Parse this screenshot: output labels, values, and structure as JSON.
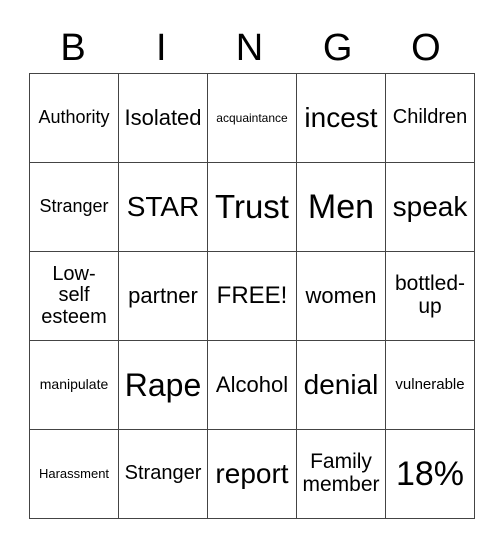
{
  "header": [
    "B",
    "I",
    "N",
    "G",
    "O"
  ],
  "cells": [
    [
      {
        "text": "Authority",
        "size": "s18"
      },
      {
        "text": "Isolated",
        "size": "s22"
      },
      {
        "text": "acquaintance",
        "size": "s12"
      },
      {
        "text": "incest",
        "size": "s28"
      },
      {
        "text": "Children",
        "size": "s20"
      }
    ],
    [
      {
        "text": "Stranger",
        "size": "s18"
      },
      {
        "text": "STAR",
        "size": "s28"
      },
      {
        "text": "Trust",
        "size": "s33"
      },
      {
        "text": "Men",
        "size": "s34"
      },
      {
        "text": "speak",
        "size": "s28"
      }
    ],
    [
      {
        "text": "Low-self esteem",
        "size": "s20"
      },
      {
        "text": "partner",
        "size": "s22"
      },
      {
        "text": "FREE!",
        "size": "s24"
      },
      {
        "text": "women",
        "size": "s22"
      },
      {
        "text": "bottled-up",
        "size": "s21"
      }
    ],
    [
      {
        "text": "manipulate",
        "size": "s14"
      },
      {
        "text": "Rape",
        "size": "s32"
      },
      {
        "text": "Alcohol",
        "size": "s22"
      },
      {
        "text": "denial",
        "size": "s28"
      },
      {
        "text": "vulnerable",
        "size": "s15"
      }
    ],
    [
      {
        "text": "Harassment",
        "size": "s13"
      },
      {
        "text": "Stranger",
        "size": "s20"
      },
      {
        "text": "report",
        "size": "s28"
      },
      {
        "text": "Family member",
        "size": "s21"
      },
      {
        "text": "18%",
        "size": "s34"
      }
    ]
  ]
}
